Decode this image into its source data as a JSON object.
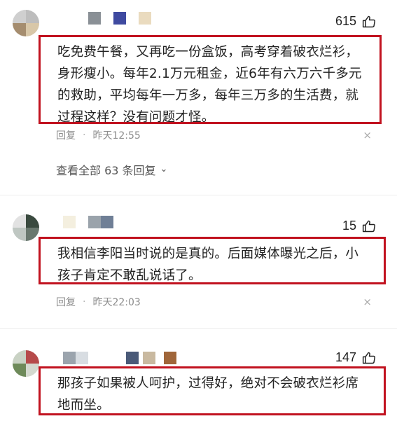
{
  "comments": [
    {
      "likes": "615",
      "text": "吃免费午餐，又再吃一份盒饭，高考穿着破衣烂衫，身形瘦小。每年2.1万元租金，近6年有六万六千多元的救助，平均每年一万多，每年三万多的生活费，就过程这样？没有问题才怪。",
      "reply_label": "回复",
      "separator": "·",
      "time": "昨天12:55",
      "close": "×",
      "view_all": "查看全部 63 条回复",
      "chevron": "⌄"
    },
    {
      "likes": "15",
      "text": "我相信李阳当时说的是真的。后面媒体曝光之后，小孩子肯定不敢乱说话了。",
      "reply_label": "回复",
      "separator": "·",
      "time": "昨天22:03",
      "close": "×"
    },
    {
      "likes": "147",
      "text": "那孩子如果被人呵护，过得好，绝对不会破衣烂衫席地而坐。"
    }
  ],
  "colors": {
    "highlight_border": "#c1121f",
    "meta_text": "#8c8c8c"
  },
  "icons": {
    "like": "thumb-up-icon",
    "close": "close-icon",
    "expand": "chevron-down-icon"
  }
}
